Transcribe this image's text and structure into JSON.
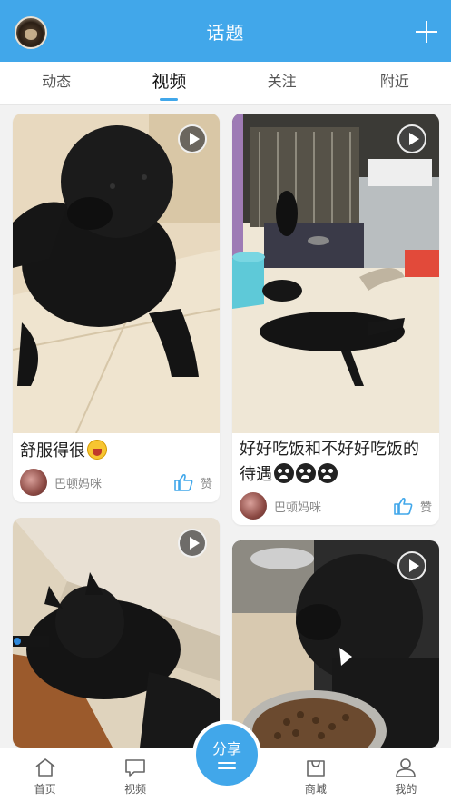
{
  "header": {
    "title": "话题"
  },
  "tabs": [
    {
      "label": "动态",
      "active": false
    },
    {
      "label": "视频",
      "active": true
    },
    {
      "label": "关注",
      "active": false
    },
    {
      "label": "附近",
      "active": false
    }
  ],
  "cards": [
    {
      "caption": "舒服得很",
      "emoji": "laugh",
      "author": "巴顿妈咪",
      "like_label": "赞"
    },
    {
      "caption": "好好吃饭和不好好吃饭的待遇",
      "emoji": "cry",
      "author": "巴顿妈咪",
      "like_label": "赞"
    },
    {
      "caption": "",
      "author": "",
      "like_label": ""
    },
    {
      "caption": "",
      "author": "",
      "like_label": ""
    }
  ],
  "bottom_nav": {
    "items": [
      {
        "label": "首页",
        "icon": "home-icon"
      },
      {
        "label": "视频",
        "icon": "chat-icon"
      },
      {
        "label": "商城",
        "icon": "shop-icon"
      },
      {
        "label": "我的",
        "icon": "profile-icon"
      }
    ],
    "share_label": "分享"
  },
  "colors": {
    "accent": "#41a7ea",
    "background": "#f2f2f2"
  }
}
